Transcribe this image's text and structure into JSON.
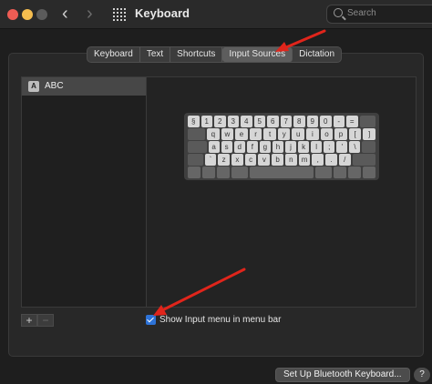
{
  "window": {
    "title": "Keyboard",
    "search_placeholder": "Search"
  },
  "tabs": [
    {
      "label": "Keyboard"
    },
    {
      "label": "Text"
    },
    {
      "label": "Shortcuts"
    },
    {
      "label": "Input Sources",
      "active": true
    },
    {
      "label": "Dictation"
    }
  ],
  "source_list": {
    "items": [
      {
        "label": "ABC",
        "icon_letter": "A"
      }
    ],
    "add_label": "+",
    "remove_label": "−"
  },
  "keyboard_rows": [
    [
      "§",
      "1",
      "2",
      "3",
      "4",
      "5",
      "6",
      "7",
      "8",
      "9",
      "0",
      "-",
      "="
    ],
    [
      "q",
      "w",
      "e",
      "r",
      "t",
      "y",
      "u",
      "i",
      "o",
      "p",
      "[",
      "]"
    ],
    [
      "a",
      "s",
      "d",
      "f",
      "g",
      "h",
      "j",
      "k",
      "l",
      ";",
      "'",
      "\\"
    ],
    [
      "`",
      "z",
      "x",
      "c",
      "v",
      "b",
      "n",
      "m",
      ",",
      ".",
      "/"
    ]
  ],
  "options": {
    "show_input_menu_label": "Show Input menu in menu bar",
    "show_input_menu_checked": true
  },
  "buttons": {
    "bluetooth_label": "Set Up Bluetooth Keyboard...",
    "help_label": "?"
  },
  "colors": {
    "accent": "#2d73d8",
    "annotation_arrow": "#e0251b"
  },
  "icons": [
    "back-arrow-icon",
    "forward-arrow-icon",
    "grid-icon",
    "search-icon",
    "abc-input-icon"
  ]
}
